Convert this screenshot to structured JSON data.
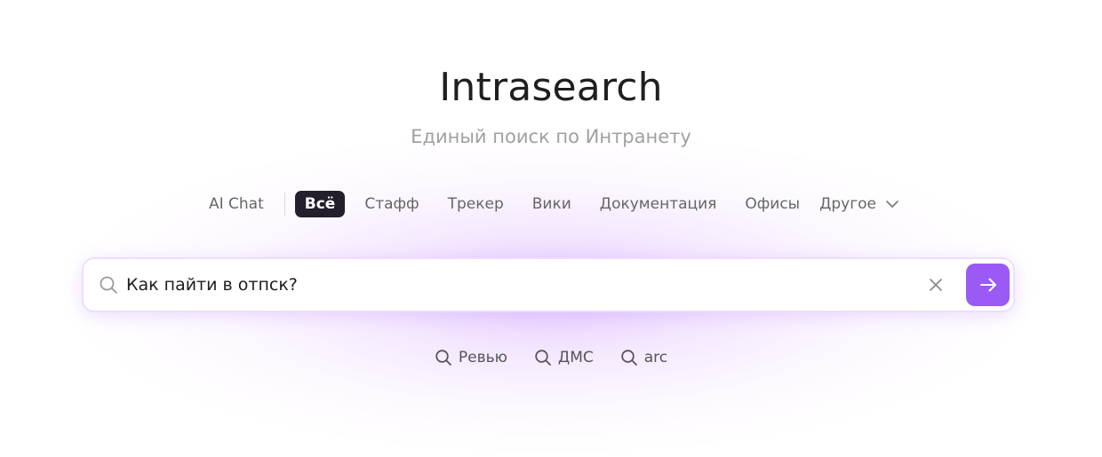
{
  "header": {
    "title": "Intrasearch",
    "subtitle": "Единый поиск по Интранету"
  },
  "tabs": {
    "ai_chat": "AI Chat",
    "items": [
      {
        "label": "Всё",
        "active": true
      },
      {
        "label": "Стафф",
        "active": false
      },
      {
        "label": "Трекер",
        "active": false
      },
      {
        "label": "Вики",
        "active": false
      },
      {
        "label": "Документация",
        "active": false
      },
      {
        "label": "Офисы",
        "active": false
      }
    ],
    "more_label": "Другое"
  },
  "search": {
    "value": "Как пайти в отпск?",
    "icon": "search-icon",
    "clear_icon": "close-icon",
    "submit_icon": "arrow-right-icon"
  },
  "suggestions": [
    {
      "label": "Ревью"
    },
    {
      "label": "ДМС"
    },
    {
      "label": "arc"
    }
  ],
  "colors": {
    "accent": "#9b59f6",
    "active_tab_bg": "#241f2c",
    "glow": "#d4a8ff"
  }
}
